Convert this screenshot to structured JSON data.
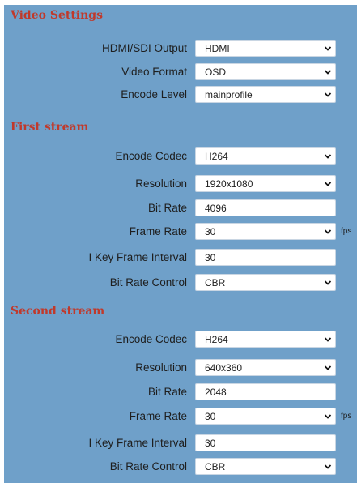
{
  "window": {
    "accent_background": "#6fa0c9",
    "heading_color": "#c0392b"
  },
  "video_settings": {
    "title": "Video Settings",
    "fields": [
      {
        "label": "HDMI/SDI Output",
        "value": "HDMI",
        "kind": "select"
      },
      {
        "label": "Video Format",
        "value": "OSD",
        "kind": "select"
      },
      {
        "label": "Encode Level",
        "value": "mainprofile",
        "kind": "select"
      }
    ]
  },
  "first_stream": {
    "title": "First stream",
    "fields": [
      {
        "label": "Encode Codec",
        "value": "H264",
        "kind": "select"
      },
      {
        "label": "Resolution",
        "value": "1920x1080",
        "kind": "select"
      },
      {
        "label": "Bit Rate",
        "value": "4096",
        "kind": "input"
      },
      {
        "label": "Frame Rate",
        "value": "30",
        "kind": "select",
        "unit": "fps"
      },
      {
        "label": "I Key Frame Interval",
        "value": "30",
        "kind": "input"
      },
      {
        "label": "Bit Rate Control",
        "value": "CBR",
        "kind": "select"
      }
    ]
  },
  "second_stream": {
    "title": "Second stream",
    "fields": [
      {
        "label": "Encode Codec",
        "value": "H264",
        "kind": "select"
      },
      {
        "label": "Resolution",
        "value": "640x360",
        "kind": "select"
      },
      {
        "label": "Bit Rate",
        "value": "2048",
        "kind": "input"
      },
      {
        "label": "Frame Rate",
        "value": "30",
        "kind": "select",
        "unit": "fps"
      },
      {
        "label": "I Key Frame Interval",
        "value": "30",
        "kind": "input"
      },
      {
        "label": "Bit Rate Control",
        "value": "CBR",
        "kind": "select"
      }
    ]
  }
}
